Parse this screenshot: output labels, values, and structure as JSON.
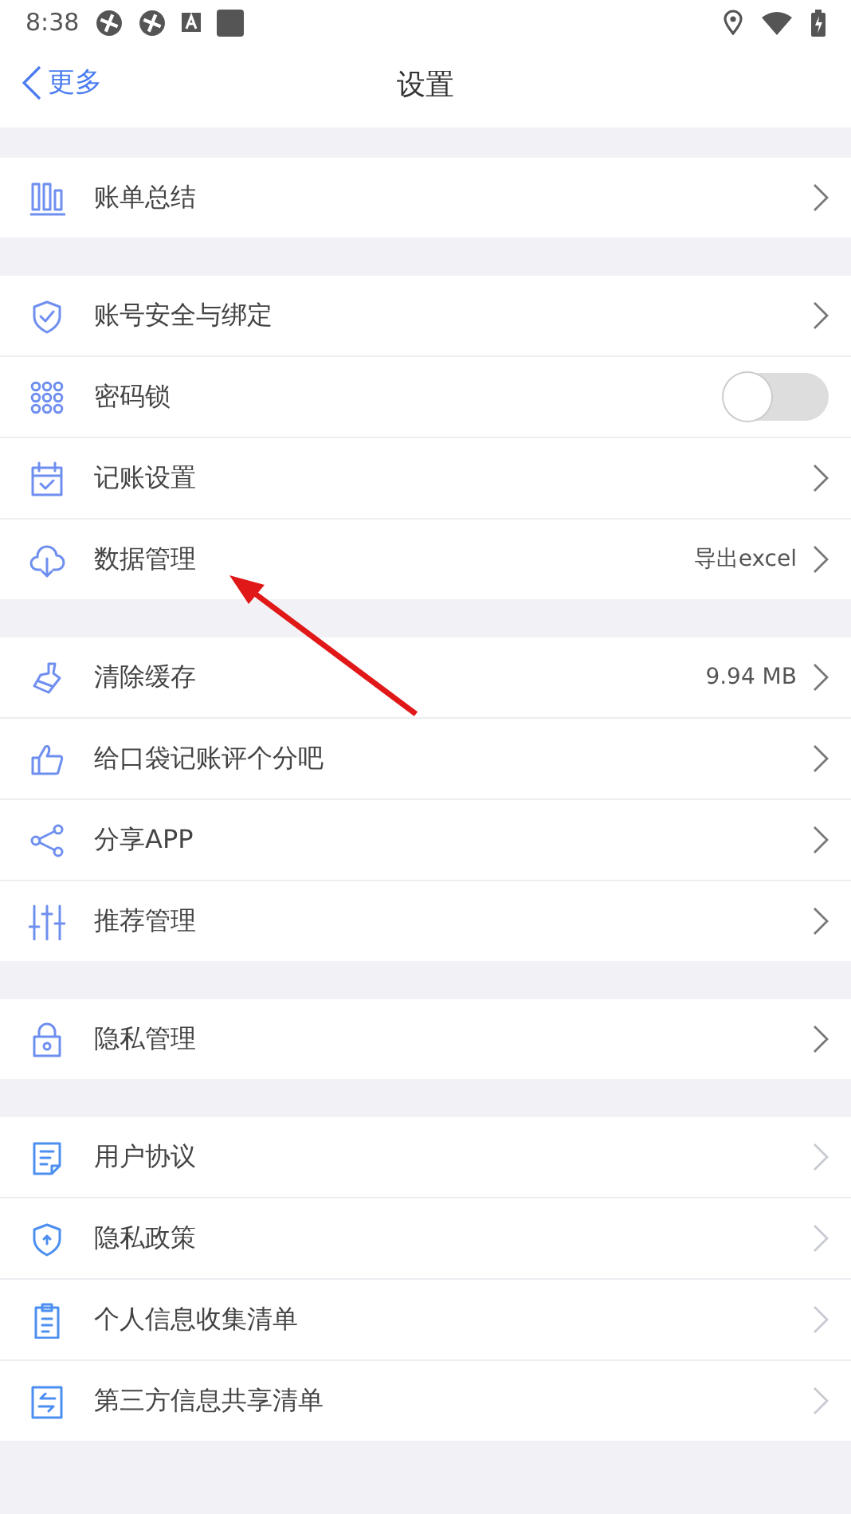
{
  "status_bar": {
    "time": "8:38"
  },
  "nav_bar": {
    "back": "更多",
    "title": "设置"
  },
  "groups": [
    {
      "rows": [
        {
          "kind": "link",
          "label": "账单总结"
        }
      ]
    },
    {
      "rows": [
        {
          "kind": "link",
          "label": "账号安全与绑定"
        },
        {
          "kind": "toggle",
          "label": "密码锁",
          "on": false
        },
        {
          "kind": "link",
          "label": "记账设置"
        },
        {
          "kind": "link",
          "label": "数据管理",
          "value": "导出excel"
        }
      ]
    },
    {
      "rows": [
        {
          "kind": "link",
          "label": "清除缓存",
          "value": "9.94 MB"
        },
        {
          "kind": "link",
          "label": "给口袋记账评个分吧"
        },
        {
          "kind": "link",
          "label": "分享APP"
        },
        {
          "kind": "link",
          "label": "推荐管理"
        }
      ]
    },
    {
      "rows": [
        {
          "kind": "link",
          "label": "隐私管理"
        }
      ]
    },
    {
      "rows": [
        {
          "kind": "link",
          "label": "用户协议"
        },
        {
          "kind": "link",
          "label": "隐私政策"
        },
        {
          "kind": "link",
          "label": "个人信息收集清单"
        },
        {
          "kind": "link",
          "label": "第三方信息共享清单"
        }
      ]
    }
  ]
}
